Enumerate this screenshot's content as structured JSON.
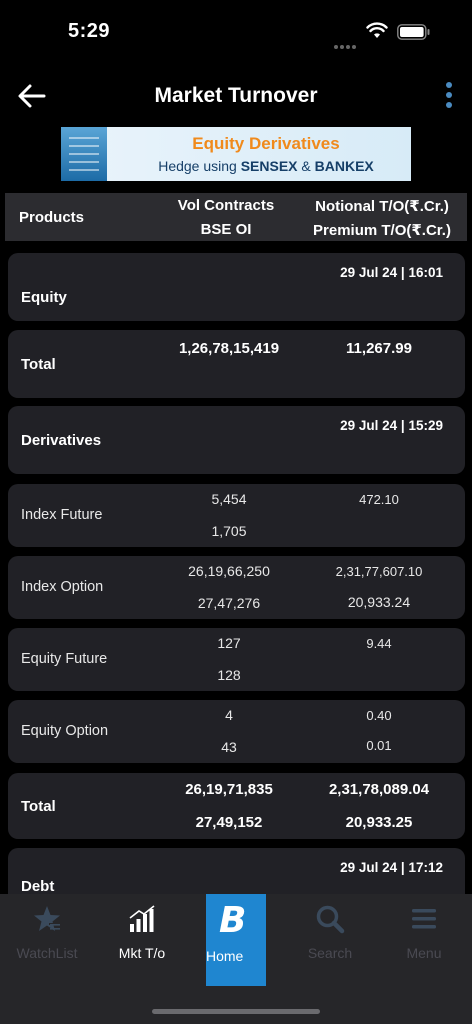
{
  "status_bar": {
    "time": "5:29"
  },
  "header": {
    "title": "Market Turnover"
  },
  "banner": {
    "title": "Equity Derivatives",
    "sub_prefix": "Hedge using ",
    "sub_sensex": "SENSEX",
    "sub_amp": " & ",
    "sub_bankex": "BANKEX"
  },
  "table_header": {
    "products": "Products",
    "col1_line1": "Vol Contracts",
    "col1_line2": "BSE OI",
    "col2_line1": "Notional T/O(₹.Cr.)",
    "col2_line2": "Premium T/O(₹.Cr.)"
  },
  "equity": {
    "title": "Equity",
    "date": "29 Jul 24 | 16:01",
    "total_label": "Total",
    "total_vol": "1,26,78,15,419",
    "total_notional": "11,267.99"
  },
  "derivatives": {
    "title": "Derivatives",
    "date": "29 Jul 24 | 15:29",
    "rows": [
      {
        "label": "Index Future",
        "vol": "5,454",
        "oi": "1,705",
        "notional": "472.10",
        "premium": ""
      },
      {
        "label": "Index Option",
        "vol": "26,19,66,250",
        "oi": "27,47,276",
        "notional": "2,31,77,607.10",
        "premium": "20,933.24"
      },
      {
        "label": "Equity Future",
        "vol": "127",
        "oi": "128",
        "notional": "9.44",
        "premium": ""
      },
      {
        "label": "Equity Option",
        "vol": "4",
        "oi": "43",
        "notional": "0.40",
        "premium": "0.01"
      }
    ],
    "total_label": "Total",
    "total_vol": "26,19,71,835",
    "total_oi": "27,49,152",
    "total_notional": "2,31,78,089.04",
    "total_premium": "20,933.25"
  },
  "debt": {
    "title": "Debt",
    "date": "29 Jul 24 | 17:12"
  },
  "bottom_nav": {
    "watchlist": "WatchList",
    "mkt_to": "Mkt T/o",
    "home": "Home",
    "home_icon": "B",
    "search": "Search",
    "menu": "Menu"
  }
}
